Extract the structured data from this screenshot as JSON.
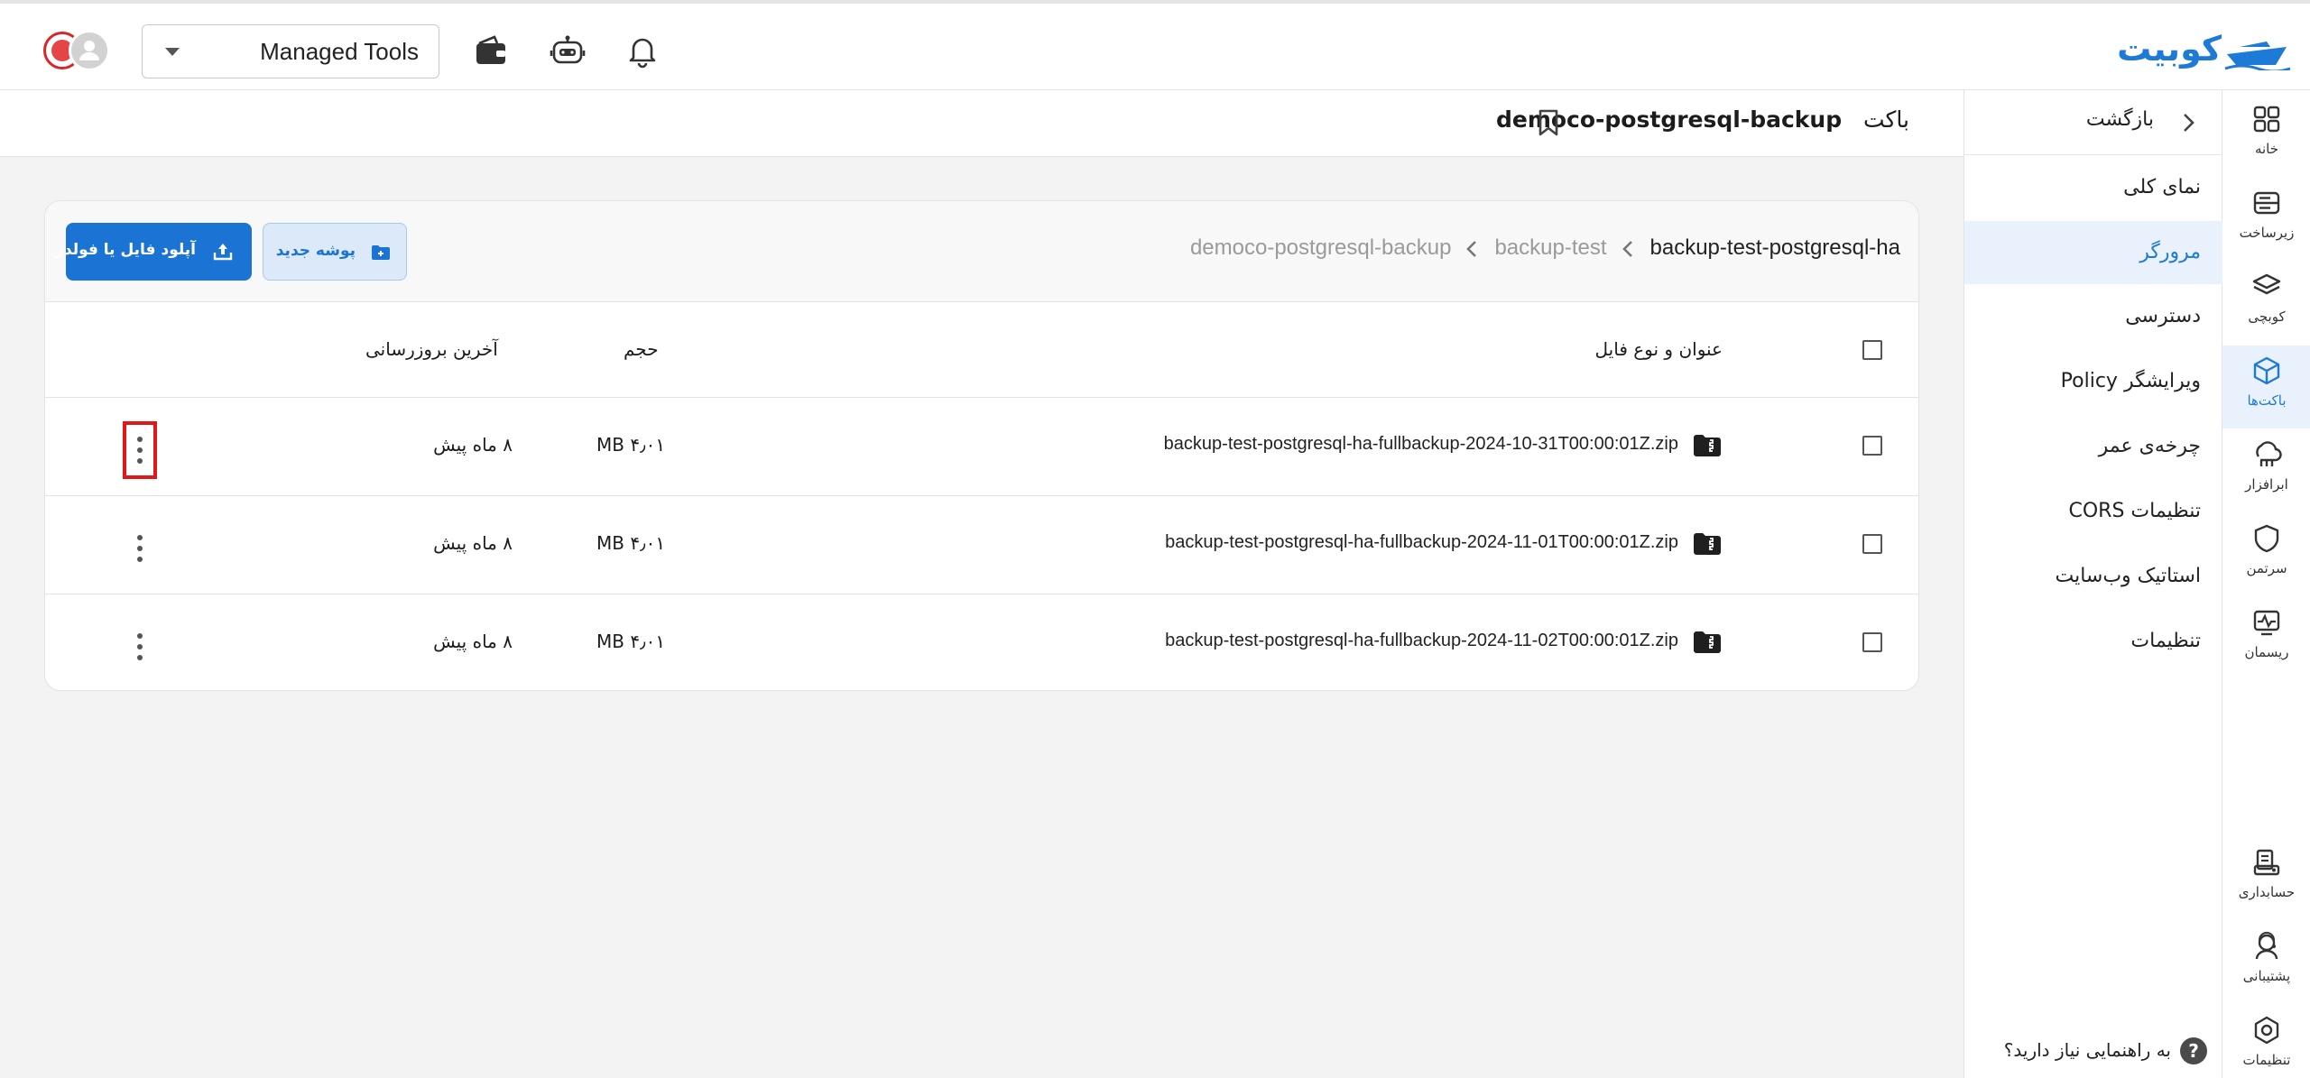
{
  "topbar": {
    "logo_text": "کوبیت",
    "project_select": {
      "value": "Managed Tools"
    }
  },
  "rail": {
    "items": [
      {
        "label": "خانه",
        "icon": "home-grid-icon"
      },
      {
        "label": "زیرساخت",
        "icon": "server-icon"
      },
      {
        "label": "کوبچی",
        "icon": "layers-icon"
      },
      {
        "label": "باکت‌ها",
        "icon": "bucket-cube-icon",
        "active": true
      },
      {
        "label": "ابرافزار",
        "icon": "cloud-app-icon"
      },
      {
        "label": "سرتمن",
        "icon": "shield-icon"
      },
      {
        "label": "ریسمان",
        "icon": "monitor-pulse-icon"
      },
      {
        "label": "حسابداری",
        "icon": "accounting-icon"
      },
      {
        "label": "پشتیبانی",
        "icon": "support-icon"
      },
      {
        "label": "تنظیمات",
        "icon": "settings-hex-icon"
      }
    ]
  },
  "sidebar": {
    "back_label": "بازگشت",
    "items": [
      {
        "label": "نمای کلی"
      },
      {
        "label": "مرورگر",
        "active": true
      },
      {
        "label": "دسترسی"
      },
      {
        "label": "ویرایشگر Policy"
      },
      {
        "label": "چرخه‌ی عمر"
      },
      {
        "label": "تنظیمات CORS"
      },
      {
        "label": "استاتیک وب‌سایت"
      },
      {
        "label": "تنظیمات"
      }
    ],
    "help_text": "به راهنمایی نیاز دارید؟",
    "help_glyph": "?"
  },
  "header": {
    "prefix": "باکت",
    "bucket_name": "democo-postgresql-backup"
  },
  "browser": {
    "breadcrumb": [
      "democo-postgresql-backup",
      "backup-test",
      "backup-test-postgresql-ha"
    ],
    "new_folder_label": "پوشه جدید",
    "upload_label": "آپلود فایل یا فولدر",
    "columns": {
      "name": "عنوان و نوع فایل",
      "size": "حجم",
      "updated": "آخرین بروزرسانی"
    },
    "rows": [
      {
        "name": "backup-test-postgresql-ha-fullbackup-2024-10-31T00:00:01Z.zip",
        "size": "۴٫۰۱ MB",
        "updated": "۸ ماه پیش",
        "menu_focused": true
      },
      {
        "name": "backup-test-postgresql-ha-fullbackup-2024-11-01T00:00:01Z.zip",
        "size": "۴٫۰۱ MB",
        "updated": "۸ ماه پیش",
        "menu_focused": false
      },
      {
        "name": "backup-test-postgresql-ha-fullbackup-2024-11-02T00:00:01Z.zip",
        "size": "۴٫۰۱ MB",
        "updated": "۸ ماه پیش",
        "menu_focused": false
      }
    ]
  },
  "colors": {
    "accent": "#1b73d3",
    "active_bg": "#e8f1fc",
    "focus_outline": "#e01818"
  }
}
